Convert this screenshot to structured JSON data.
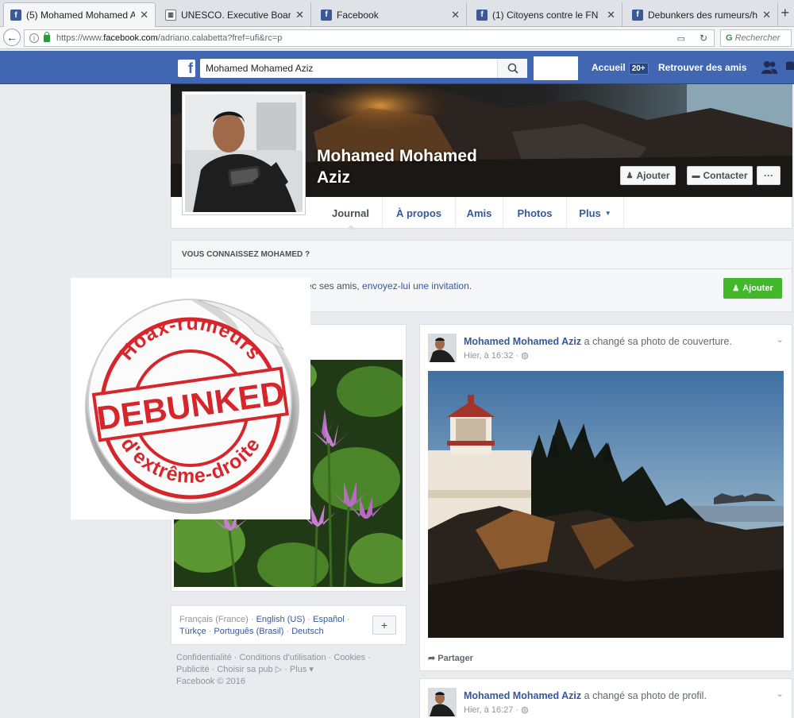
{
  "browser": {
    "tabs": [
      {
        "title": "(5) Mohamed Mohamed A...",
        "icon": "facebook-icon",
        "active": true
      },
      {
        "title": "UNESCO. Executive Board; ...",
        "icon": "unesco-icon",
        "active": false
      },
      {
        "title": "Facebook",
        "icon": "facebook-icon",
        "active": false
      },
      {
        "title": "(1) Citoyens contre le FN",
        "icon": "facebook-icon",
        "active": false
      },
      {
        "title": "Debunkers des rumeurs/ho...",
        "icon": "facebook-icon",
        "active": false
      }
    ],
    "url_prefix": "https://www.",
    "url_host": "facebook.com",
    "url_path": "/adriano.calabetta?fref=ufi&rc=p",
    "search_placeholder": "Rechercher"
  },
  "fb_header": {
    "search_value": "Mohamed Mohamed Aziz",
    "home_label": "Accueil",
    "home_badge": "20+",
    "find_friends_label": "Retrouver des amis",
    "brand_color": "#4267b2"
  },
  "profile": {
    "name_line1": "Mohamed Mohamed",
    "name_line2": "Aziz",
    "add_button": "Ajouter",
    "contact_button": "Contacter",
    "more_button": "···",
    "tabs": [
      "Journal",
      "À propos",
      "Amis",
      "Photos",
      "Plus"
    ]
  },
  "know": {
    "heading": "VOUS CONNAISSEZ MOHAMED ?",
    "text_before": "ec ses amis, ",
    "link": "envoyez-lui une invitation",
    "text_after": ".",
    "add_button": "Ajouter",
    "button_color": "#42b72a"
  },
  "languages": {
    "current": "Français (France)",
    "links": [
      "English (US)",
      "Español",
      "Türkçe",
      "Português (Brasil)",
      "Deutsch"
    ],
    "plus": "+"
  },
  "footer": {
    "line1": "Confidentialité · Conditions d'utilisation · Cookies ·",
    "line2": "Publicité · Choisir sa pub ▷ · Plus ▾",
    "line3": "Facebook © 2016"
  },
  "posts": [
    {
      "author": "Mohamed Mohamed Aziz",
      "action": " a changé sa photo de couverture.",
      "time": "Hier, à 16:32 ·",
      "share": "Partager"
    },
    {
      "author": "Mohamed Mohamed Aziz",
      "action": " a changé sa photo de profil.",
      "time": "Hier, à 16:27 ·"
    }
  ],
  "sticker": {
    "top_text": "Hoax-rumeurs",
    "center_text": "DEBUNKED",
    "bottom_text": "d'extrême-droite",
    "color": "#d7262b"
  }
}
